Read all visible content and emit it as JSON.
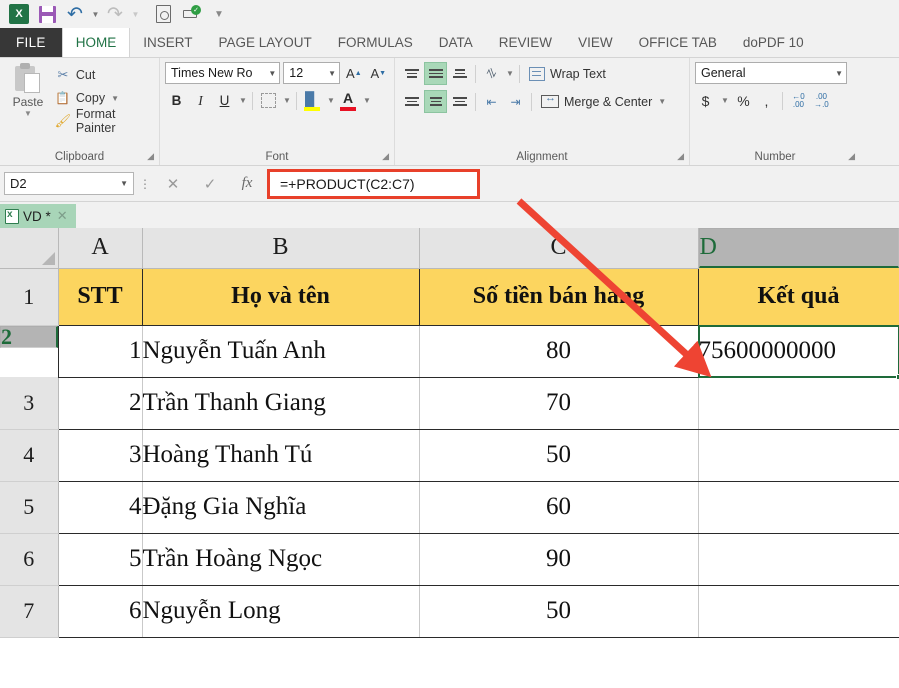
{
  "quick_access": {
    "items": [
      {
        "name": "excel-logo",
        "label": "X"
      },
      {
        "name": "save-icon",
        "label": "Save"
      },
      {
        "name": "undo-icon",
        "label": "Undo"
      },
      {
        "name": "redo-icon",
        "label": "Redo"
      },
      {
        "name": "print-preview-icon",
        "label": "Print Preview"
      },
      {
        "name": "quick-print-icon",
        "label": "Quick Print"
      },
      {
        "name": "customize-qat-icon",
        "label": "Customize"
      }
    ]
  },
  "ribbon": {
    "tabs": [
      {
        "label": "FILE",
        "active": false
      },
      {
        "label": "HOME",
        "active": true
      },
      {
        "label": "INSERT",
        "active": false
      },
      {
        "label": "PAGE LAYOUT",
        "active": false
      },
      {
        "label": "FORMULAS",
        "active": false
      },
      {
        "label": "DATA",
        "active": false
      },
      {
        "label": "REVIEW",
        "active": false
      },
      {
        "label": "VIEW",
        "active": false
      },
      {
        "label": "OFFICE TAB",
        "active": false
      },
      {
        "label": "doPDF 10",
        "active": false
      }
    ],
    "clipboard": {
      "group_label": "Clipboard",
      "paste_label": "Paste",
      "cut_label": "Cut",
      "copy_label": "Copy",
      "format_painter_label": "Format Painter"
    },
    "font": {
      "group_label": "Font",
      "font_name": "Times New Ro",
      "font_size": "12",
      "grow_label": "A",
      "shrink_label": "A",
      "bold_label": "B",
      "italic_label": "I",
      "underline_label": "U"
    },
    "alignment": {
      "group_label": "Alignment",
      "wrap_text_label": "Wrap Text",
      "merge_center_label": "Merge & Center"
    },
    "number": {
      "group_label": "Number",
      "format": "General",
      "currency_label": "$",
      "percent_label": "%",
      "comma_label": ",",
      "increase_decimal_label": ".00",
      "decrease_decimal_label": ".00"
    }
  },
  "formula_bar": {
    "name_box": "D2",
    "cancel_label": "✕",
    "enter_label": "✓",
    "function_label": "fx",
    "formula": "=+PRODUCT(C2:C7)",
    "highlight_color": "#e8402a"
  },
  "sheet_tabs": {
    "active_tab": "VD *",
    "close_label": "✕"
  },
  "grid": {
    "columns": [
      "A",
      "B",
      "C",
      "D"
    ],
    "selected_column": "D",
    "rows": [
      "1",
      "2",
      "3",
      "4",
      "5",
      "6",
      "7"
    ],
    "selected_row": "2",
    "selected_cell": "D2",
    "header_fill": "#fcd55f",
    "selection_color": "#1e6b3a",
    "data": [
      {
        "row": "1",
        "A": "STT",
        "B": "Họ và tên",
        "C": "Số tiền bán hàng",
        "D": "Kết quả",
        "is_header": true
      },
      {
        "row": "2",
        "A": "1",
        "B": "Nguyễn Tuấn Anh",
        "C": "80",
        "D": "75600000000",
        "is_header": false
      },
      {
        "row": "3",
        "A": "2",
        "B": "Trần Thanh Giang",
        "C": "70",
        "D": "",
        "is_header": false
      },
      {
        "row": "4",
        "A": "3",
        "B": "Hoàng Thanh Tú",
        "C": "50",
        "D": "",
        "is_header": false
      },
      {
        "row": "5",
        "A": "4",
        "B": "Đặng Gia Nghĩa",
        "C": "60",
        "D": "",
        "is_header": false
      },
      {
        "row": "6",
        "A": "5",
        "B": "Trần Hoàng Ngọc",
        "C": "90",
        "D": "",
        "is_header": false
      },
      {
        "row": "7",
        "A": "6",
        "B": "Nguyễn Long",
        "C": "50",
        "D": "",
        "is_header": false
      }
    ]
  },
  "annotation": {
    "arrow_color": "#ee4433",
    "description": "red arrow from formula bar to cell D2"
  }
}
